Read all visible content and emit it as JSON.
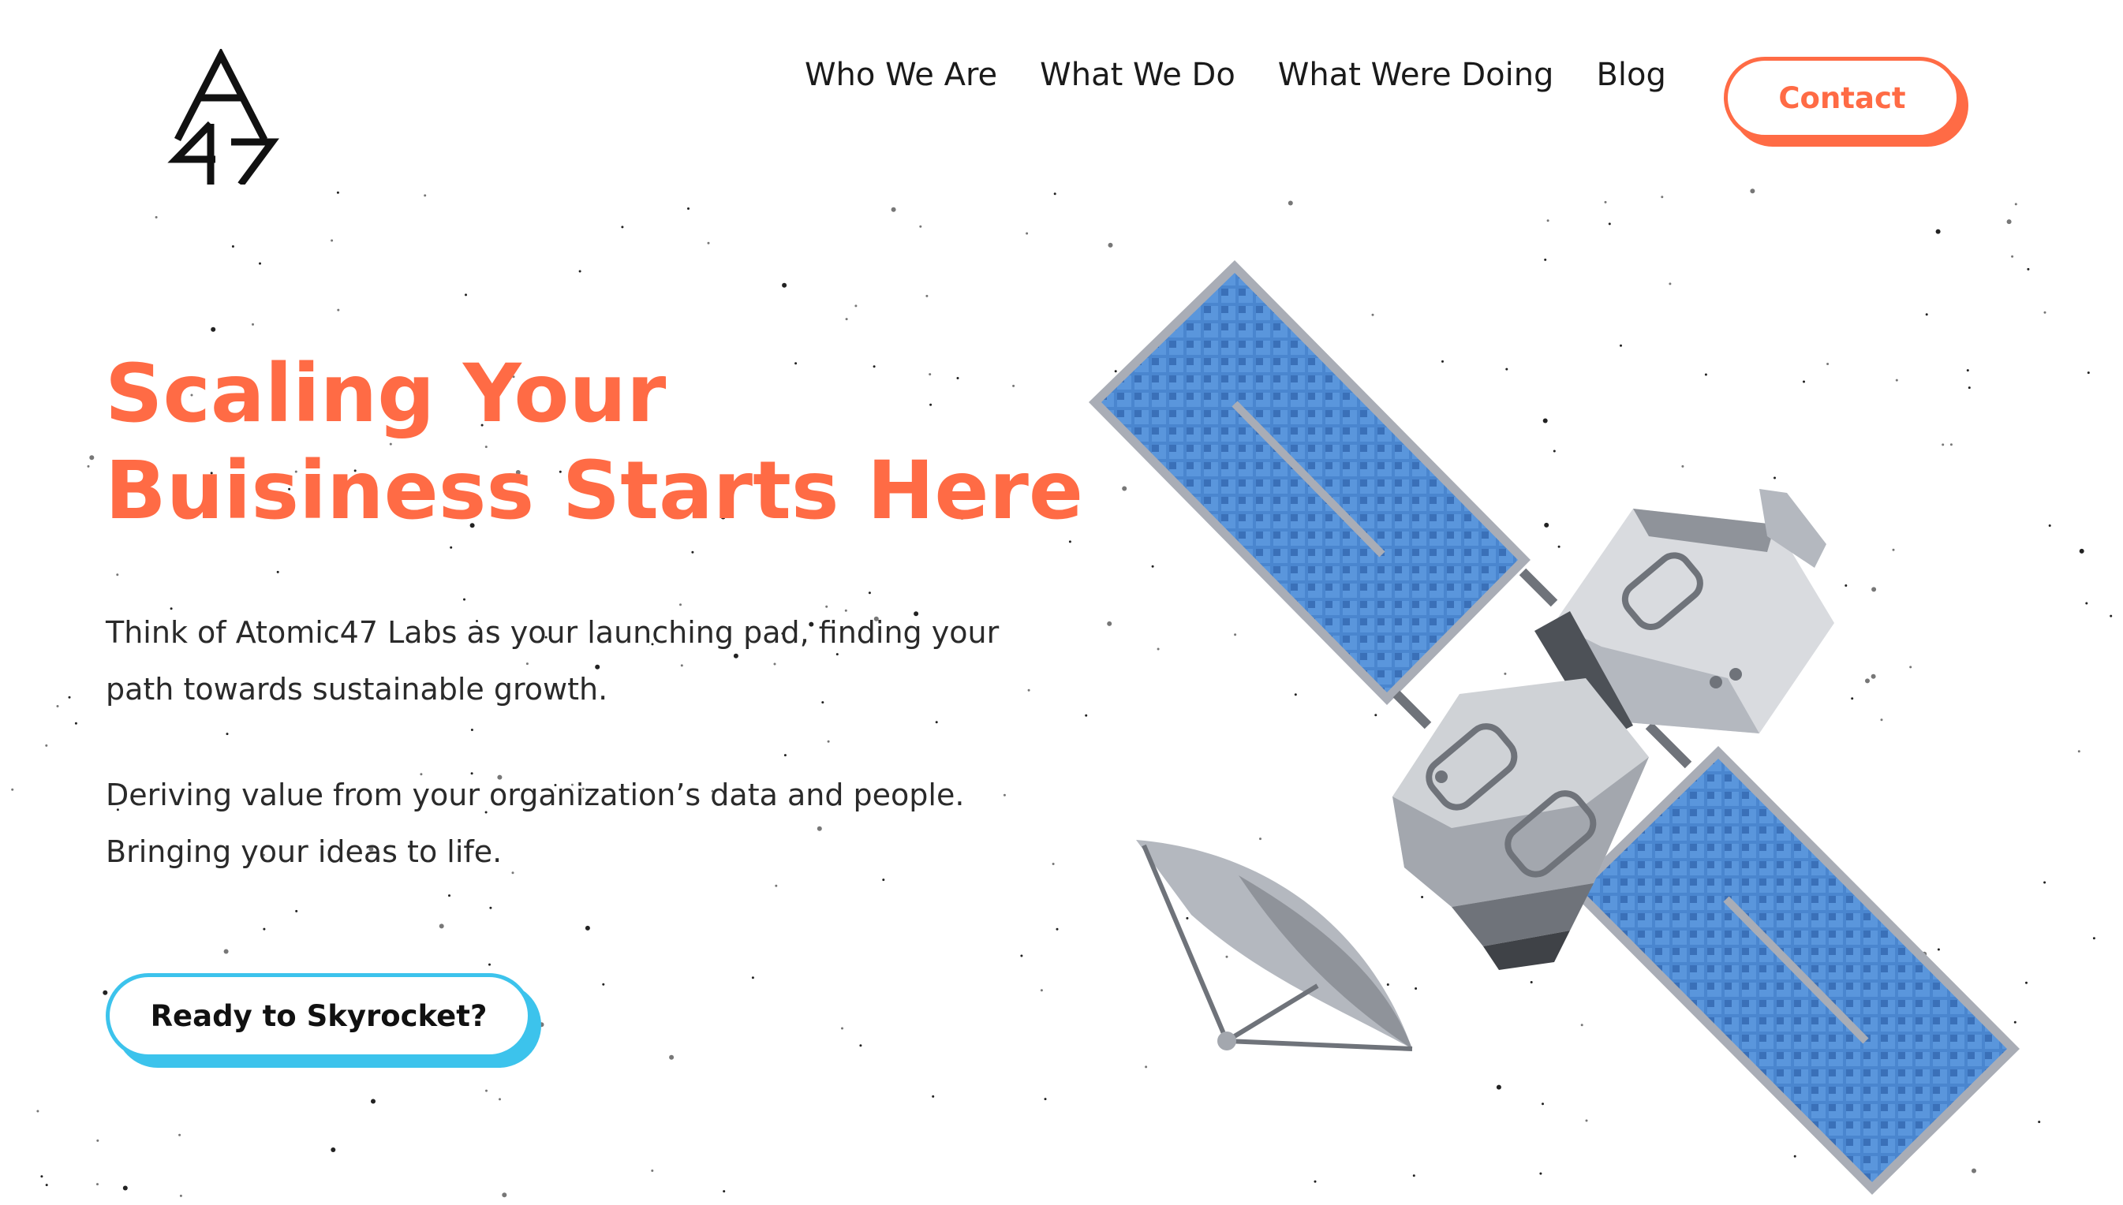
{
  "brand": {
    "logo_text": "A47"
  },
  "nav": {
    "items": [
      {
        "label": "Who We Are"
      },
      {
        "label": "What We Do"
      },
      {
        "label": "What Were Doing"
      },
      {
        "label": "Blog"
      }
    ],
    "contact_label": "Contact"
  },
  "hero": {
    "title_line1": "Scaling Your",
    "title_line2": "Buisiness Starts Here",
    "paragraph1_line1": "Think of Atomic47 Labs as your launching pad, finding your",
    "paragraph1_line2": "path towards sustainable growth.",
    "paragraph2_line1": "Deriving value from your organization’s data and people.",
    "paragraph2_line2": "Bringing your ideas to life.",
    "cta_label": "Ready to Skyrocket?"
  },
  "colors": {
    "accent": "#ff6b45",
    "cta_border": "#3cc3ec",
    "panel_blue": "#4a86cf",
    "panel_dark": "#2e64a6",
    "panel_frame": "#a9adb6",
    "body_light": "#d9dbdf",
    "body_mid": "#b4b8bf",
    "body_dark": "#6f737a"
  },
  "icons": {
    "logo": "atomic47-logo",
    "illustration": "satellite-illustration"
  }
}
